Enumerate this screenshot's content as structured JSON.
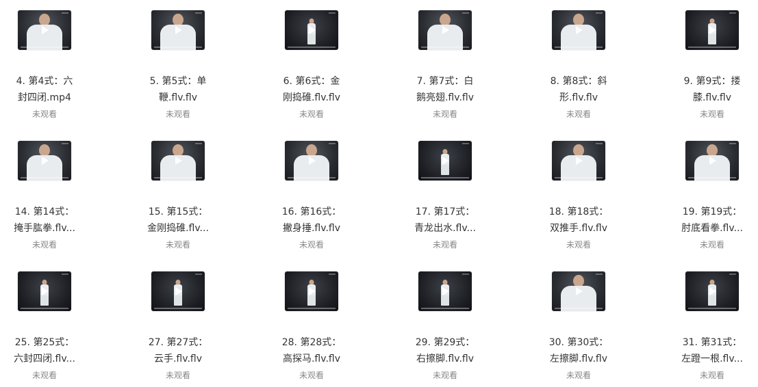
{
  "videos": [
    {
      "line1": "4. 第4式：六",
      "line2": "封四闭.mp4",
      "status": "未观看",
      "shot": "close"
    },
    {
      "line1": "5. 第5式：单",
      "line2": "鞭.flv.flv",
      "status": "未观看",
      "shot": "close"
    },
    {
      "line1": "6. 第6式：金",
      "line2": "刚捣碓.flv.flv",
      "status": "未观看",
      "shot": "far"
    },
    {
      "line1": "7. 第7式：白",
      "line2": "鹅亮翅.flv.flv",
      "status": "未观看",
      "shot": "close"
    },
    {
      "line1": "8. 第8式：斜",
      "line2": "形.flv.flv",
      "status": "未观看",
      "shot": "close"
    },
    {
      "line1": "9. 第9式：搂",
      "line2": "膝.flv.flv",
      "status": "未观看",
      "shot": "far"
    },
    {
      "line1": "14. 第14式：",
      "line2": "掩手肱拳.flv...",
      "status": "未观看",
      "shot": "close"
    },
    {
      "line1": "15. 第15式：",
      "line2": "金刚捣碓.flv...",
      "status": "未观看",
      "shot": "close"
    },
    {
      "line1": "16. 第16式：",
      "line2": "撇身捶.flv.flv",
      "status": "未观看",
      "shot": "close"
    },
    {
      "line1": "17. 第17式：",
      "line2": "青龙出水.flv...",
      "status": "未观看",
      "shot": "far"
    },
    {
      "line1": "18. 第18式：",
      "line2": "双推手.flv.flv",
      "status": "未观看",
      "shot": "close"
    },
    {
      "line1": "19. 第19式：",
      "line2": "肘底看拳.flv...",
      "status": "未观看",
      "shot": "close"
    },
    {
      "line1": "25. 第25式：",
      "line2": "六封四闭.flv...",
      "status": "未观看",
      "shot": "far"
    },
    {
      "line1": "27. 第27式：",
      "line2": "云手.flv.flv",
      "status": "未观看",
      "shot": "far"
    },
    {
      "line1": "28. 第28式：",
      "line2": "高探马.flv.flv",
      "status": "未观看",
      "shot": "far"
    },
    {
      "line1": "29. 第29式：",
      "line2": "右擦脚.flv.flv",
      "status": "未观看",
      "shot": "far"
    },
    {
      "line1": "30. 第30式：",
      "line2": "左擦脚.flv.flv",
      "status": "未观看",
      "shot": "close"
    },
    {
      "line1": "31. 第31式：",
      "line2": "左蹬一根.flv...",
      "status": "未观看",
      "shot": "far"
    }
  ],
  "icons": {
    "play": "play-icon"
  },
  "colors": {
    "title": "#333333",
    "status": "#888888"
  }
}
